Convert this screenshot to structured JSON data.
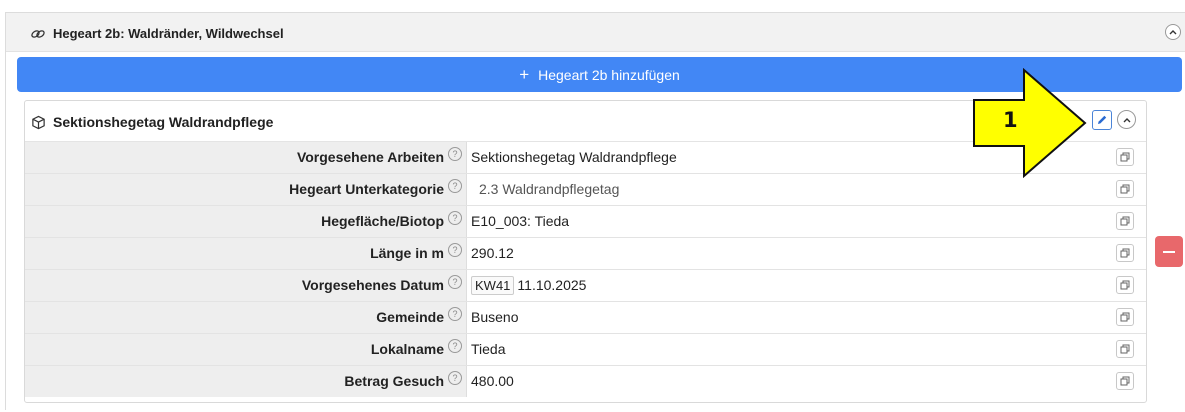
{
  "section": {
    "title": "Hegeart 2b: Waldränder, Wildwechsel",
    "add_button_label": "Hegeart 2b hinzufügen",
    "add_icon": "plus-icon"
  },
  "card": {
    "title": "Sektionshegetag Waldrandpflege",
    "icon": "cube-icon",
    "rows": [
      {
        "label": "Vorgesehene Arbeiten",
        "value": "Sektionshegetag Waldrandpflege"
      },
      {
        "label": "Hegeart Unterkategorie",
        "value": "2.3 Waldrandpflegetag"
      },
      {
        "label": "Hegefläche/Biotop",
        "value": "E10_003: Tieda"
      },
      {
        "label": "Länge in m",
        "value": "290.12"
      },
      {
        "label": "Vorgesehenes Datum",
        "badge": "KW41",
        "value": "11.10.2025"
      },
      {
        "label": "Gemeinde",
        "value": "Buseno"
      },
      {
        "label": "Lokalname",
        "value": "Tieda"
      },
      {
        "label": "Betrag Gesuch",
        "value": "480.00"
      }
    ]
  },
  "annotation": {
    "number": "1",
    "color": "#ffff00"
  },
  "colors": {
    "primary_button": "#4287f5",
    "danger_button": "#e8686b"
  }
}
